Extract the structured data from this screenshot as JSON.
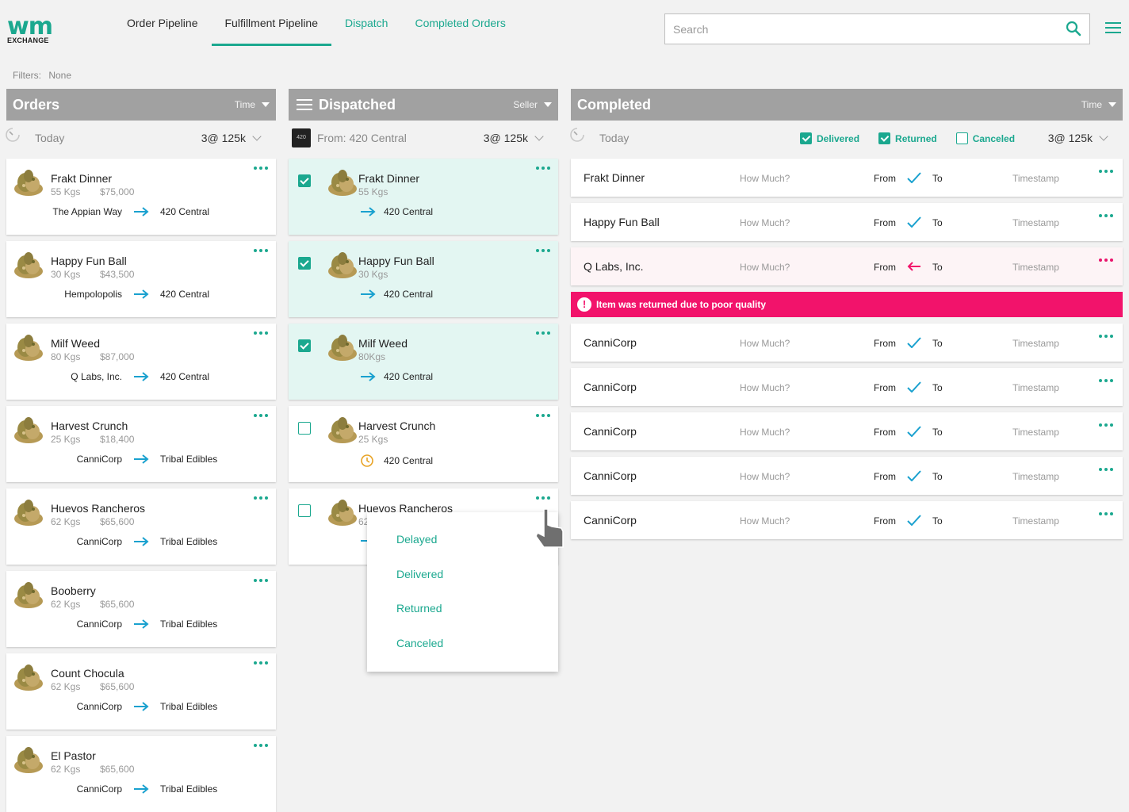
{
  "brand": {
    "wm": "wm",
    "exchange": "EXCHANGE"
  },
  "nav": {
    "tabs": [
      {
        "label": "Order Pipeline"
      },
      {
        "label": "Fulfillment Pipeline"
      },
      {
        "label": "Dispatch"
      },
      {
        "label": "Completed Orders"
      }
    ],
    "active": "Fulfillment Pipeline"
  },
  "search": {
    "placeholder": "Search"
  },
  "filters": {
    "label": "Filters:",
    "value": "None"
  },
  "orders": {
    "title": "Orders",
    "sort": "Time",
    "group": {
      "label": "Today",
      "summary": "3@ 125k"
    },
    "cards": [
      {
        "name": "Frakt Dinner",
        "weight": "55 Kgs",
        "price": "$75,000",
        "from": "The Appian Way",
        "to": "420 Central"
      },
      {
        "name": "Happy Fun Ball",
        "weight": "30 Kgs",
        "price": "$43,500",
        "from": "Hempolopolis",
        "to": "420 Central"
      },
      {
        "name": "Milf Weed",
        "weight": "80 Kgs",
        "price": "$87,000",
        "from": "Q Labs, Inc.",
        "to": "420 Central"
      },
      {
        "name": "Harvest Crunch",
        "weight": "25 Kgs",
        "price": "$18,400",
        "from": "CanniCorp",
        "to": "Tribal Edibles"
      },
      {
        "name": "Huevos Rancheros",
        "weight": "62 Kgs",
        "price": "$65,600",
        "from": "CanniCorp",
        "to": "Tribal Edibles"
      },
      {
        "name": "Booberry",
        "weight": "62 Kgs",
        "price": "$65,600",
        "from": "CanniCorp",
        "to": "Tribal Edibles"
      },
      {
        "name": "Count Chocula",
        "weight": "62 Kgs",
        "price": "$65,600",
        "from": "CanniCorp",
        "to": "Tribal Edibles"
      },
      {
        "name": "El Pastor",
        "weight": "62 Kgs",
        "price": "$65,600",
        "from": "CanniCorp",
        "to": "Tribal Edibles"
      }
    ]
  },
  "dispatched": {
    "title": "Dispatched",
    "sort": "Seller",
    "group": {
      "label": "From: 420 Central",
      "summary": "3@ 125k",
      "logo": "420"
    },
    "cards": [
      {
        "name": "Frakt Dinner",
        "weight": "55 Kgs",
        "to": "420 Central",
        "checked": true
      },
      {
        "name": "Happy Fun Ball",
        "weight": "30 Kgs",
        "to": "420 Central",
        "checked": true
      },
      {
        "name": "Milf Weed",
        "weight": "80Kgs",
        "to": "420 Central",
        "checked": true
      },
      {
        "name": "Harvest Crunch",
        "weight": "25 Kgs",
        "to": "420 Central",
        "checked": false,
        "delayed": true
      },
      {
        "name": "Huevos Rancheros",
        "weight": "62",
        "to": "",
        "checked": false
      }
    ]
  },
  "status_menu": {
    "options": [
      "Delayed",
      "Delivered",
      "Returned",
      "Canceled"
    ]
  },
  "completed": {
    "title": "Completed",
    "sort": "Time",
    "group": {
      "label": "Today",
      "summary": "3@ 125k"
    },
    "filters": [
      {
        "label": "Delivered",
        "checked": true
      },
      {
        "label": "Returned",
        "checked": true
      },
      {
        "label": "Canceled",
        "checked": false
      }
    ],
    "columns": {
      "how_much": "How Much?",
      "from": "From",
      "to": "To",
      "timestamp": "Timestamp"
    },
    "rows": [
      {
        "name": "Frakt Dinner",
        "status": "delivered"
      },
      {
        "name": "Happy Fun Ball",
        "status": "delivered"
      },
      {
        "name": "Q Labs, Inc.",
        "status": "returned"
      },
      {
        "name": "CanniCorp",
        "status": "delivered"
      },
      {
        "name": "CanniCorp",
        "status": "delivered"
      },
      {
        "name": "CanniCorp",
        "status": "delivered"
      },
      {
        "name": "CanniCorp",
        "status": "delivered"
      },
      {
        "name": "CanniCorp",
        "status": "delivered"
      }
    ],
    "alert": "Item was returned due to poor quality"
  },
  "colors": {
    "accent": "#1ba88f",
    "arrow": "#1aa1cf",
    "danger": "#f2136b",
    "delay": "#e8a325",
    "header": "#a1a1a1"
  }
}
